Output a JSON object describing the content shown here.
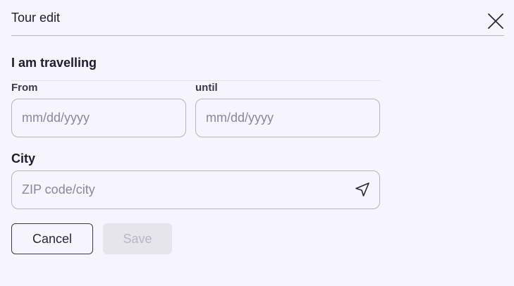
{
  "dialog": {
    "title": "Tour edit"
  },
  "section": {
    "heading": "I am travelling"
  },
  "dates": {
    "from_label": "From",
    "from_placeholder": "mm/dd/yyyy",
    "from_value": "",
    "until_label": "until",
    "until_placeholder": "mm/dd/yyyy",
    "until_value": ""
  },
  "city": {
    "label": "City",
    "placeholder": "ZIP code/city",
    "value": "",
    "icon": "location-arrow-icon"
  },
  "actions": {
    "cancel_label": "Cancel",
    "save_label": "Save",
    "save_disabled": true
  },
  "icons": {
    "close": "close-icon"
  },
  "colors": {
    "background": "#f6f5fe",
    "text": "#1f1d2b",
    "border": "#b5b2c4",
    "disabled_bg": "#e6e5ec",
    "disabled_text": "#b9b8c2"
  }
}
